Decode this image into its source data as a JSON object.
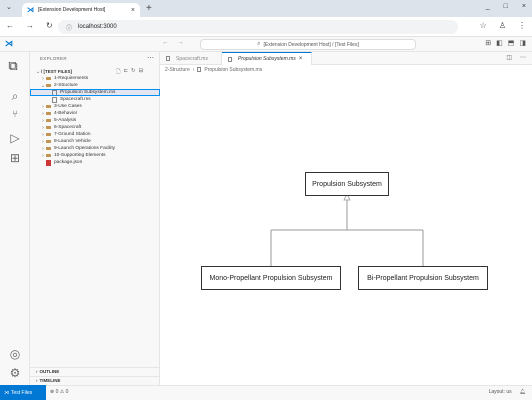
{
  "browser": {
    "tab_title": "[Extension Development Host] ",
    "tab_close": "×",
    "new_tab": "+",
    "url": "localhost:3000",
    "window_controls": [
      "_",
      "□",
      "×"
    ]
  },
  "vscode": {
    "command_center": "[Extension Development Host] / [Test Files]",
    "explorer_header": "EXPLORER",
    "tree": [
      {
        "label": "/ [TEST FILES]",
        "level": 0,
        "kind": "root",
        "expanded": true
      },
      {
        "label": "1-Requirements",
        "level": 1,
        "kind": "folder",
        "expanded": false
      },
      {
        "label": "2-Structure",
        "level": 1,
        "kind": "folder",
        "expanded": true
      },
      {
        "label": "Propulsion Subsystem.ms",
        "level": 2,
        "kind": "file",
        "selected": true
      },
      {
        "label": "Spacecraft.ms",
        "level": 2,
        "kind": "file"
      },
      {
        "label": "3-Use Cases",
        "level": 1,
        "kind": "folder",
        "expanded": false
      },
      {
        "label": "4-Behavior",
        "level": 1,
        "kind": "folder",
        "expanded": false
      },
      {
        "label": "5-Analysis",
        "level": 1,
        "kind": "folder",
        "expanded": false
      },
      {
        "label": "6-Spacecraft",
        "level": 1,
        "kind": "folder",
        "expanded": false
      },
      {
        "label": "7-Ground Station",
        "level": 1,
        "kind": "folder",
        "expanded": false
      },
      {
        "label": "8-Launch Vehicle",
        "level": 1,
        "kind": "folder",
        "expanded": false
      },
      {
        "label": "9-Launch Operations Facility",
        "level": 1,
        "kind": "folder",
        "expanded": false
      },
      {
        "label": "10-Supporting Elements",
        "level": 1,
        "kind": "folder",
        "expanded": false
      },
      {
        "label": "package.json",
        "level": 1,
        "kind": "json"
      }
    ],
    "sections": {
      "outline": "OUTLINE",
      "timeline": "TIMELINE"
    },
    "editor_tabs": [
      {
        "label": "Spacecraft.ms",
        "active": false
      },
      {
        "label": "Propulsion Subsystem.ms",
        "active": true
      }
    ],
    "breadcrumb": {
      "folder": "2-Structure",
      "file": "Propulsion Subsystem.ms"
    },
    "diagram": {
      "root": "Propulsion Subsystem",
      "children": [
        "Mono-Propellant Propulsion Subsystem",
        "Bi-Propellant Propulsion Subsystem"
      ]
    },
    "status": {
      "remote": "Test Files",
      "problems": "⊗ 0 ⚠ 0",
      "layout": "Layout: us"
    }
  }
}
